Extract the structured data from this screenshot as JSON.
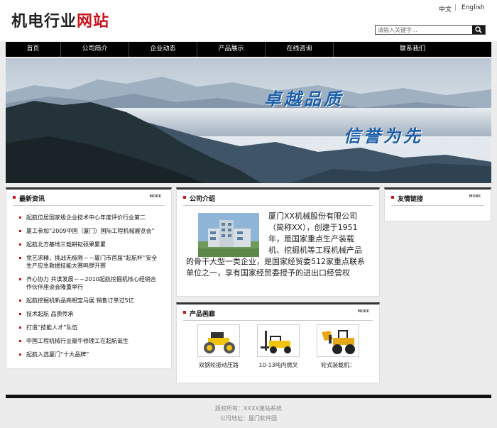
{
  "header": {
    "logo_part1": "机电行业",
    "logo_part2": "网站",
    "lang_zh": "中文",
    "lang_sep": "|",
    "lang_en": "English",
    "search_placeholder": "请输入关键字..."
  },
  "nav": [
    "首页",
    "公司简介",
    "企业动态",
    "产品展示",
    "在线咨询",
    "联系我们"
  ],
  "banner": {
    "slogan1": "卓越品质",
    "slogan2": "信誉为先"
  },
  "news": {
    "title": "最新资讯",
    "more": "MORE",
    "items": [
      "起航位居国家级企业技术中心年度评价行业第二",
      "厦工参加“2009中国（厦门）国际工程机械展览会”",
      "起航北方基地三载耕耘硕果累累",
      "竞艺求精，挑战无极限－－厦门市首届“起航杯”安全生产应急救援技能大赛鸣锣开赛",
      "齐心协力 共谋发展－－2010起航挖掘机核心经销合作伙伴座谈会隆重举行",
      "起航挖掘机新品亮相宝马展 销售订单过5亿",
      "技术起航 品质传承",
      "打造“技能人才”队伍",
      "中国工程机械行业最牛修理工在起航诞生",
      "起航入选厦门“十大品牌”"
    ]
  },
  "about": {
    "title": "公司介绍",
    "text": "厦门XX机械股份有限公司（简称XX），创建于1951年，是国家重点生产装载机、挖掘机等工程机械产品的骨干大型一类企业，是国家经贸委512家重点联系单位之一，享有国家经贸委授予的进出口经营权"
  },
  "products": {
    "title": "产品画廊",
    "more": "MORE",
    "items": [
      {
        "name": "双钢轮振动压路",
        "icon": "road-roller-icon"
      },
      {
        "name": "10-13吨内燃叉",
        "icon": "forklift-icon"
      },
      {
        "name": "轮式装载机：",
        "icon": "wheel-loader-icon"
      }
    ]
  },
  "links": {
    "title": "友情链接",
    "more": "MORE"
  },
  "footer": {
    "line1": "版权所有：XXXX建站系统",
    "line2": "公司地址：厦门软件园"
  },
  "colors": {
    "accent": "#c8141c",
    "nav_bg": "#000000",
    "slogan": "#1d5fa8"
  }
}
